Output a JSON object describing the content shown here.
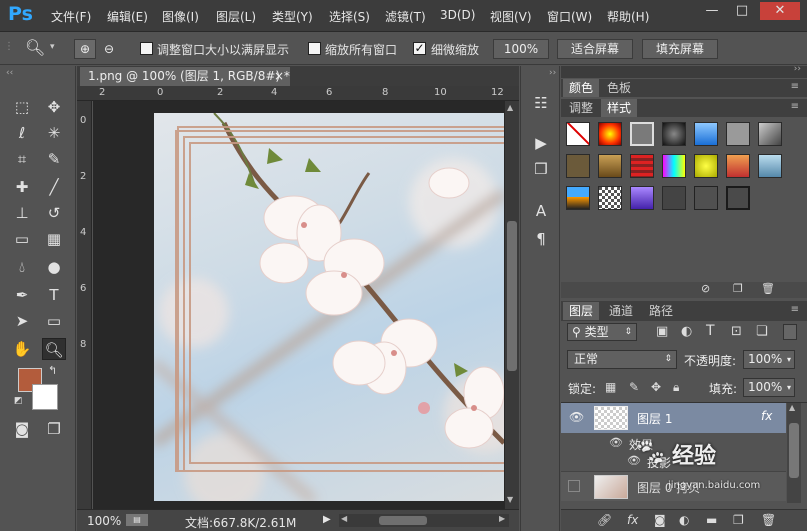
{
  "app": {
    "logo": "Ps"
  },
  "menu": [
    "文件(F)",
    "编辑(E)",
    "图像(I)",
    "图层(L)",
    "类型(Y)",
    "选择(S)",
    "滤镜(T)",
    "3D(D)",
    "视图(V)",
    "窗口(W)",
    "帮助(H)"
  ],
  "window_controls": {
    "minimize": "—",
    "maximize": "□",
    "close": "✕"
  },
  "options": {
    "resize_windows_label": "调整窗口大小以满屏显示",
    "zoom_all_label": "缩放所有窗口",
    "scrubby_zoom_label": "细微缩放",
    "zoom_value": "100%",
    "fit_screen": "适合屏幕",
    "fill_screen": "填充屏幕"
  },
  "document": {
    "tab_title": "1.png @ 100% (图层 1, RGB/8#) *",
    "close": "×",
    "ruler_top": [
      "2",
      "0",
      "2",
      "4",
      "6",
      "8",
      "10",
      "12"
    ],
    "ruler_left": [
      "0",
      "2",
      "4",
      "6",
      "8"
    ],
    "status": {
      "zoom": "100%",
      "info": "文档:667.8K/2.61M"
    }
  },
  "panels": {
    "top_tabs": [
      "颜色",
      "色板"
    ],
    "style_tabs": [
      "调整",
      "样式"
    ],
    "layers_tabs": [
      "图层",
      "通道",
      "路径"
    ],
    "filter_kind": "类型",
    "blend_mode": "正常",
    "opacity_label": "不透明度:",
    "opacity_value": "100%",
    "lock_label": "锁定:",
    "fill_label": "填充:",
    "fill_value": "100%",
    "layers": [
      {
        "name": "图层 1",
        "fx": "fx"
      },
      {
        "name": "图层 0 拷贝"
      }
    ],
    "effects_label": "效果",
    "effect_item": "投影"
  },
  "watermark": {
    "text": "经验",
    "sub": "jingyan.baidu.com"
  },
  "colors": {
    "foreground": "#b35c3c",
    "background": "#ffffff",
    "accent": "#31a8ff"
  }
}
